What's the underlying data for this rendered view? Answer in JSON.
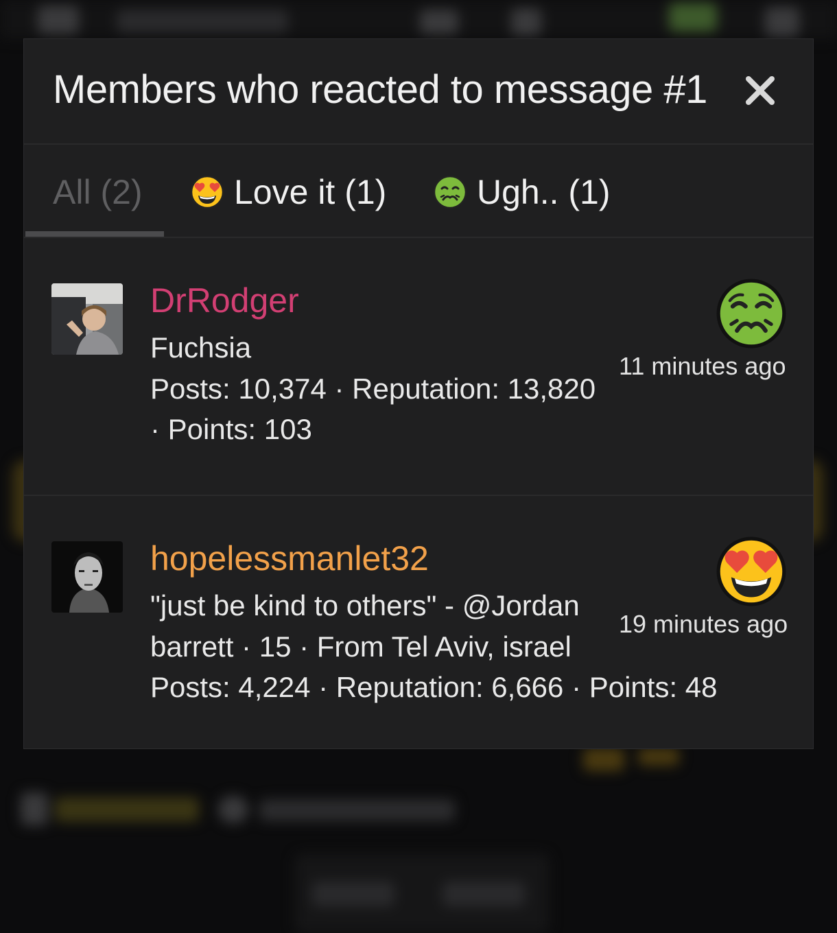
{
  "modal": {
    "title": "Members who reacted to message #1",
    "close_label": "×"
  },
  "tabs": [
    {
      "label": "All (2)",
      "active": true
    },
    {
      "label": "Love it (1)",
      "icon": "heart-eyes-emoji",
      "active": false
    },
    {
      "label": "Ugh.. (1)",
      "icon": "nauseated-emoji",
      "active": false
    }
  ],
  "members": [
    {
      "username": "DrRodger",
      "username_color": "#d23f73",
      "lines": [
        "Fuchsia",
        "Posts: 10,374 · Reputation: 13,820",
        "· Points: 103"
      ],
      "reaction_icon": "nauseated-emoji",
      "time": "11 minutes ago"
    },
    {
      "username": "hopelessmanlet32",
      "username_color": "#f2a14a",
      "lines": [
        "\"just be kind to others\" - @Jordan",
        "barrett · 15 · From Tel Aviv, israel",
        "Posts: 4,224 · Reputation: 6,666 · Points: 48"
      ],
      "reaction_icon": "heart-eyes-emoji",
      "time": "19 minutes ago"
    }
  ],
  "colors": {
    "modal_bg": "#1f1f20",
    "text": "#f1f1f1",
    "inactive_tab": "#5f5f61"
  }
}
